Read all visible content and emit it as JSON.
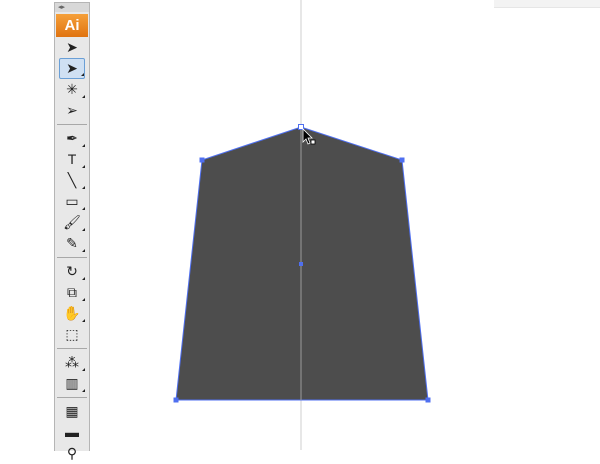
{
  "app": {
    "logo": "Ai"
  },
  "toolbar": {
    "groups": [
      [
        {
          "id": "selection",
          "icon": "➤"
        },
        {
          "id": "direct-selection",
          "icon": "➤",
          "selected": true
        },
        {
          "id": "magic-wand",
          "icon": "✳"
        },
        {
          "id": "lasso",
          "icon": "➢"
        }
      ],
      [
        {
          "id": "pen",
          "icon": "✒"
        },
        {
          "id": "type",
          "icon": "T"
        },
        {
          "id": "line-segment",
          "icon": "╲"
        },
        {
          "id": "rectangle",
          "icon": "▭"
        },
        {
          "id": "paintbrush",
          "icon": "🖌"
        },
        {
          "id": "pencil",
          "icon": "✎"
        }
      ],
      [
        {
          "id": "rotate",
          "icon": "↻"
        },
        {
          "id": "scale",
          "icon": "⧉"
        },
        {
          "id": "warp",
          "icon": "✋"
        },
        {
          "id": "free-transform",
          "icon": "⬚"
        }
      ],
      [
        {
          "id": "symbol-sprayer",
          "icon": "⁂"
        },
        {
          "id": "column-graph",
          "icon": "▥"
        }
      ],
      [
        {
          "id": "mesh",
          "icon": "▦"
        },
        {
          "id": "gradient",
          "icon": "▬"
        },
        {
          "id": "eyedropper",
          "icon": "⚲"
        }
      ]
    ]
  },
  "colors": {
    "shape_fill": "#4d4d4d",
    "path_stroke": "#4f6ff0",
    "guide": "#cccccc"
  }
}
